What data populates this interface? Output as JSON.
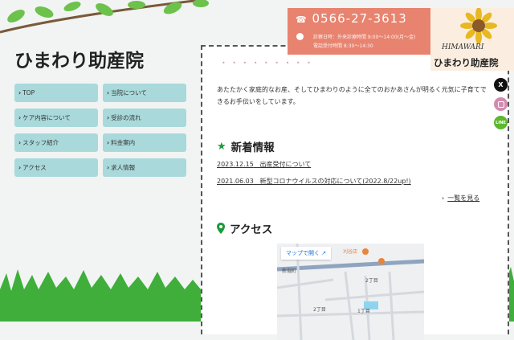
{
  "site": {
    "title": "ひまわり助産院"
  },
  "nav": [
    {
      "label": "TOP"
    },
    {
      "label": "当院について"
    },
    {
      "label": "ケア内容について"
    },
    {
      "label": "受診の流れ"
    },
    {
      "label": "スタッフ紹介"
    },
    {
      "label": "料金案内"
    },
    {
      "label": "アクセス"
    },
    {
      "label": "求人情報"
    }
  ],
  "contact": {
    "phone": "0566-27-3613",
    "hours_line1": "診察日時：外来診療時間 9:00〜14:00(月〜金)",
    "hours_line2": "電話受付時間 8:30〜14:30"
  },
  "logo": {
    "script": "HIMAWARI",
    "name": "ひまわり助産院"
  },
  "main": {
    "intro": "あたたかく家庭的なお産、そしてひまわりのように全てのおかあさんが明るく元気に子育てできるお手伝いをしています。",
    "news_heading": "新着情報",
    "news": [
      {
        "date": "2023.12.15",
        "title": "出産受付について"
      },
      {
        "date": "2021.06.03",
        "title": "新型コロナウイルスの対応について(2022.8/22up!)"
      }
    ],
    "more": "一覧を見る",
    "access_heading": "アクセス",
    "map_button": "マップで開く",
    "map_labels": [
      "新堀町",
      "2丁目",
      "1丁目",
      "2丁目",
      "刈谷店"
    ]
  },
  "social": {
    "x": "X",
    "instagram": "instagram",
    "line": "LINE"
  },
  "colors": {
    "nav": "#a9d9db",
    "contact": "#e8836f",
    "logo_bg": "#fbeee0",
    "accent": "#1a9a3a"
  }
}
